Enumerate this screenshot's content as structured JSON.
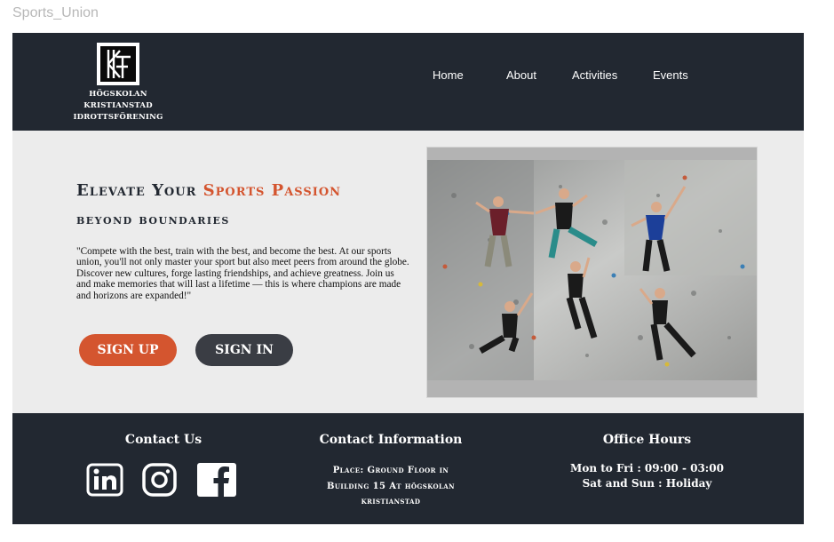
{
  "app": {
    "title": "Sports_Union"
  },
  "header": {
    "logo_lines": [
      "HÖGSKOLAN",
      "KRISTIANSTAD",
      "IDROTTSFÖRENING"
    ],
    "nav": [
      {
        "label": "Home"
      },
      {
        "label": "About"
      },
      {
        "label": "Activities"
      },
      {
        "label": "Events"
      }
    ]
  },
  "hero": {
    "title_part1": "Elevate Your ",
    "title_accent": "Sports Passion",
    "subtitle": "beyond boundaries",
    "description": "\"Compete with the best, train with the best, and become the best. At our sports union, you'll not only master your sport but also meet peers from around the globe. Discover new cultures, forge lasting friendships, and achieve greatness. Join us and make memories that will last a lifetime — this is where champions are made and horizons are expanded!\"",
    "signup_label": "SIGN UP",
    "signin_label": "SIGN IN"
  },
  "footer": {
    "contact_us": {
      "heading": "Contact Us",
      "icons": [
        "linkedin-icon",
        "instagram-icon",
        "facebook-icon"
      ]
    },
    "contact_info": {
      "heading": "Contact Information",
      "line1": "Place: Ground Floor in",
      "line2": "Building 15 At högskolan",
      "line3": "kristianstad"
    },
    "office_hours": {
      "heading": "Office Hours",
      "weekdays": "Mon to Fri : 09:00 - 03:00",
      "weekend": "Sat and Sun : Holiday"
    }
  },
  "colors": {
    "dark": "#222831",
    "accent": "#d4552f",
    "hero_bg": "#ececec",
    "signin_bg": "#3a3d44"
  }
}
